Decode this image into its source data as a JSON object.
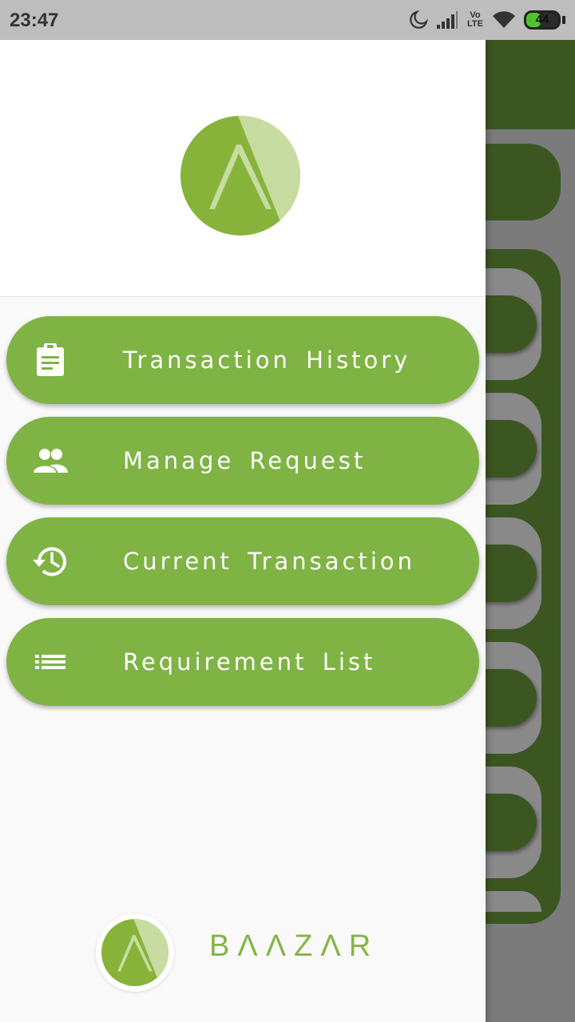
{
  "status_bar": {
    "time": "23:47",
    "network_label": "Vo LTE",
    "battery_percent": "44",
    "battery_level": 0.44,
    "icons": [
      "moon-icon",
      "signal-icon",
      "wifi-icon",
      "battery-icon"
    ]
  },
  "drawer": {
    "menu_items": [
      {
        "label": "Transaction History",
        "icon": "clipboard-icon"
      },
      {
        "label": "Manage Request",
        "icon": "people-icon"
      },
      {
        "label": "Current Transaction",
        "icon": "history-icon"
      },
      {
        "label": "Requirement List",
        "icon": "list-icon"
      }
    ],
    "brand_name": "BΛΛZΛR"
  },
  "colors": {
    "accent": "#7fb344",
    "logo_dark": "#87b33a",
    "logo_light": "#c7dca0",
    "background_app_green": "#3c5622",
    "status_bar": "#bdbdbd",
    "drawer_background": "#f9f9f9"
  }
}
